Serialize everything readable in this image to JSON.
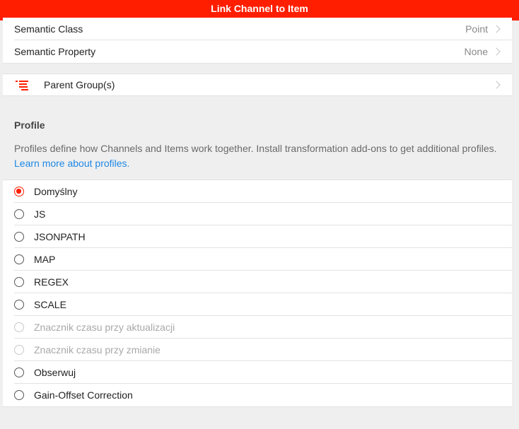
{
  "header": {
    "title": "Link Channel to Item"
  },
  "semantics": {
    "class_label": "Semantic Class",
    "class_value": "Point",
    "property_label": "Semantic Property",
    "property_value": "None"
  },
  "parent": {
    "label": "Parent Group(s)",
    "icon": "list-icon"
  },
  "profile": {
    "title": "Profile",
    "description": "Profiles define how Channels and Items work together. Install transformation add-ons to get additional profiles.",
    "link_text": "Learn more about profiles.",
    "options": [
      {
        "label": "Domyślny",
        "checked": true,
        "disabled": false
      },
      {
        "label": "JS",
        "checked": false,
        "disabled": false
      },
      {
        "label": "JSONPATH",
        "checked": false,
        "disabled": false
      },
      {
        "label": "MAP",
        "checked": false,
        "disabled": false
      },
      {
        "label": "REGEX",
        "checked": false,
        "disabled": false
      },
      {
        "label": "SCALE",
        "checked": false,
        "disabled": false
      },
      {
        "label": "Znacznik czasu przy aktualizacji",
        "checked": false,
        "disabled": true
      },
      {
        "label": "Znacznik czasu przy zmianie",
        "checked": false,
        "disabled": true
      },
      {
        "label": "Obserwuj",
        "checked": false,
        "disabled": false
      },
      {
        "label": "Gain-Offset Correction",
        "checked": false,
        "disabled": false
      }
    ]
  },
  "colors": {
    "accent": "#ff1e00",
    "link": "#1e88e5",
    "background": "#efefef"
  }
}
